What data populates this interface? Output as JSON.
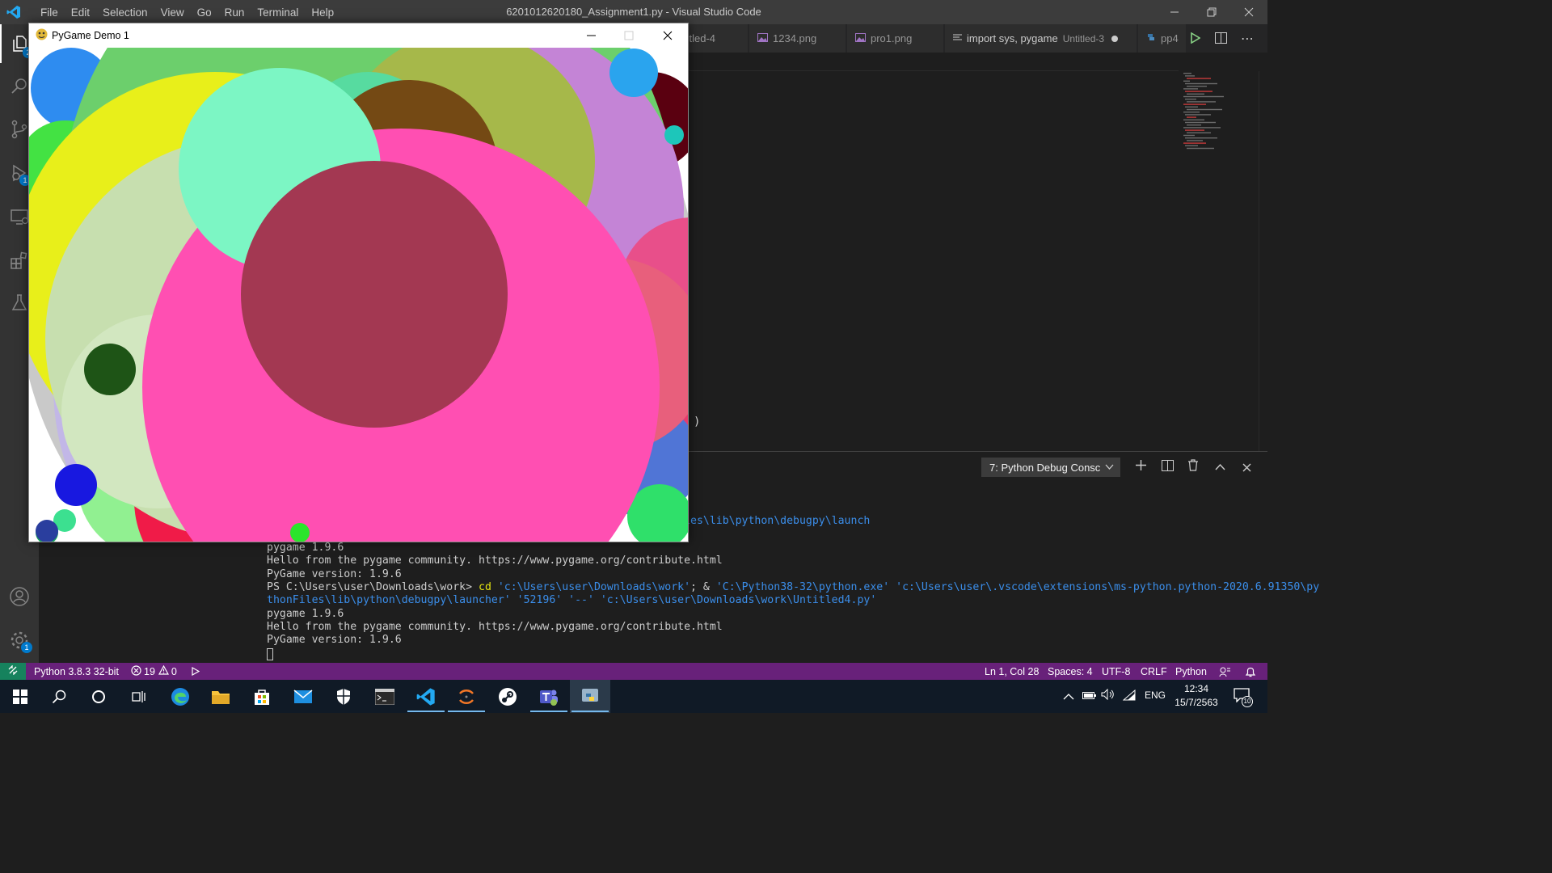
{
  "window": {
    "title": "6201012620180_Assignment1.py - Visual Studio Code",
    "menu": [
      "File",
      "Edit",
      "Selection",
      "View",
      "Go",
      "Run",
      "Terminal",
      "Help"
    ]
  },
  "activity_badges": {
    "explorer": "2",
    "debug": "1",
    "settings": "1"
  },
  "tabs": [
    {
      "label": "titled-4",
      "icon": "file-icon"
    },
    {
      "label": "1234.png",
      "icon": "image-icon"
    },
    {
      "label": "pro1.png",
      "icon": "image-icon"
    },
    {
      "label": "import sys, pygame",
      "desc": "Untitled-3",
      "icon": "text-icon",
      "dirty": true
    },
    {
      "label": "pp4",
      "icon": "python-icon"
    }
  ],
  "editor": {
    "bracket": ")"
  },
  "panel": {
    "terminal_select": "7: Python Debug Consc",
    "lines": [
      {
        "text": "rs\\user\\.vscode\\extensions\\ms-python.python-2020.6.91350\\pythonFiles\\lib\\python\\debugpy\\launch",
        "cls": "blue"
      },
      {
        "text": "pygame 1.9.6",
        "cls": ""
      },
      {
        "text": "Hello from the pygame community. https://www.pygame.org/contribute.html",
        "cls": ""
      },
      {
        "text": "PyGame version: 1.9.6",
        "cls": ""
      }
    ],
    "prompt": "PS C:\\Users\\user\\Downloads\\work> ",
    "cmd_cd": "cd",
    "cmd_path1": "'c:\\Users\\user\\Downloads\\work'",
    "cmd_amp": "; & ",
    "cmd_exe": "'C:\\Python38-32\\python.exe'",
    "cmd_rest": " 'c:\\Users\\user\\.vscode\\extensions\\ms-python.python-2020.6.91350\\py",
    "cmd_cont": "thonFiles\\lib\\python\\debugpy\\launcher' '52196' '--' 'c:\\Users\\user\\Downloads\\work\\Untitled4.py'",
    "after": [
      "pygame 1.9.6",
      "Hello from the pygame community. https://www.pygame.org/contribute.html",
      "PyGame version: 1.9.6"
    ]
  },
  "status": {
    "interpreter": "Python 3.8.3 32-bit",
    "errors": "19",
    "warnings": "0",
    "position": "Ln 1, Col 28",
    "spaces": "Spaces: 4",
    "encoding": "UTF-8",
    "eol": "CRLF",
    "language": "Python"
  },
  "taskbar": {
    "lang": "ENG",
    "time": "12:34",
    "date": "15/7/2563",
    "notif": "10"
  },
  "pygame": {
    "title": "PyGame Demo 1",
    "circles": [
      {
        "color": "#c9c9c9"
      },
      {
        "color": "#2e8cf0"
      },
      {
        "color": "#e11fd0"
      },
      {
        "color": "#43e243"
      },
      {
        "color": "#5a0010"
      },
      {
        "color": "#6ccf6c"
      },
      {
        "color": "#f7e86a"
      },
      {
        "color": "#e63b6e"
      },
      {
        "color": "#5075d6"
      },
      {
        "color": "#2fe06a"
      },
      {
        "color": "#f01b48"
      },
      {
        "color": "#c2b7e7"
      },
      {
        "color": "#91f091"
      },
      {
        "color": "#2a0a12"
      },
      {
        "color": "#e84f8a"
      },
      {
        "color": "#b3cd61"
      },
      {
        "color": "#a6b84a"
      },
      {
        "color": "#e8ef1a"
      },
      {
        "color": "#c7dfaf"
      },
      {
        "color": "#d2e7c0"
      },
      {
        "color": "#c80d8f"
      },
      {
        "color": "#c484d6"
      },
      {
        "color": "#b2d86b"
      },
      {
        "color": "#e85f7c"
      },
      {
        "color": "#744914"
      },
      {
        "color": "#ff4fb2"
      },
      {
        "color": "#7cf6c4"
      },
      {
        "color": "#a33852"
      },
      {
        "color": "#1e5416"
      },
      {
        "color": "#1818e0"
      },
      {
        "color": "#2aa4ee"
      },
      {
        "color": "#1dc6ba"
      },
      {
        "color": "#17a85a"
      },
      {
        "color": "#2be52b"
      },
      {
        "color": "#3ce090"
      },
      {
        "color": "#2a3e9e"
      },
      {
        "color": "#e3e06f"
      },
      {
        "color": "#b34fd3"
      },
      {
        "color": "#57dba0"
      }
    ]
  }
}
